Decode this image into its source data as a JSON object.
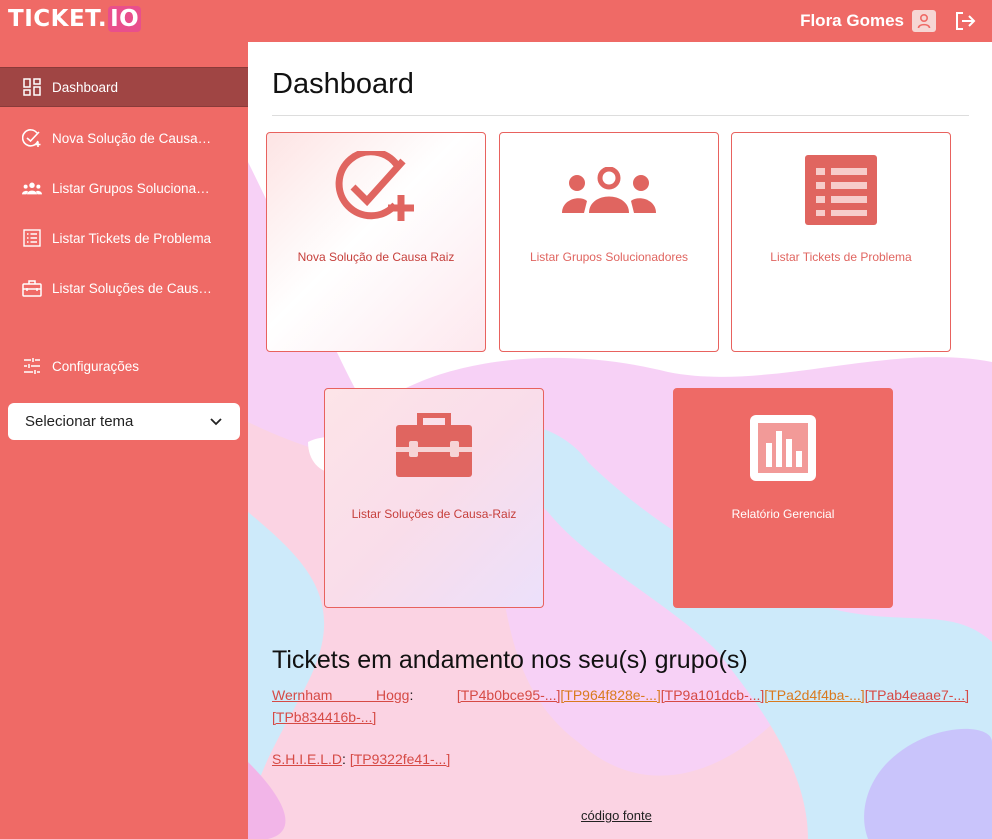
{
  "app": {
    "logo_main": "TICKET.",
    "logo_suffix": "IO"
  },
  "header": {
    "user_name": "Flora Gomes"
  },
  "sidebar": {
    "items": [
      {
        "label": "Dashboard",
        "icon": "dashboard-icon"
      },
      {
        "label": "Nova Solução de Causa Raiz",
        "icon": "check-plus-icon"
      },
      {
        "label": "Listar Grupos Solucionadores",
        "icon": "group-icon"
      },
      {
        "label": "Listar Tickets de Problema",
        "icon": "list-icon"
      },
      {
        "label": "Listar Soluções de Causa-Raiz",
        "icon": "toolbox-icon"
      },
      {
        "label": "Configurações",
        "icon": "sliders-icon"
      }
    ],
    "theme_select": "Selecionar tema"
  },
  "main": {
    "title": "Dashboard",
    "cards": [
      {
        "label": "Nova Solução de Causa Raiz",
        "icon": "check-plus-icon"
      },
      {
        "label": "Listar Grupos Solucionadores",
        "icon": "group-icon"
      },
      {
        "label": "Listar Tickets de Problema",
        "icon": "list-icon"
      },
      {
        "label": "Listar Soluções de Causa-Raiz",
        "icon": "toolbox-icon"
      },
      {
        "label": "Relatório Gerencial",
        "icon": "bar-chart-icon"
      }
    ],
    "tickets_title": "Tickets em andamento nos seu(s) grupo(s)",
    "groups": [
      {
        "name": "Wernham Hogg",
        "tickets": [
          "[TP4b0bce95-...]",
          "[TP964f828e-...]",
          "[TP9a101dcb-...]",
          "[TPa2d4f4ba-...]",
          "[TPab4eaae7-...]",
          "[TPb834416b-...]"
        ]
      },
      {
        "name": "S.H.I.E.L.D",
        "tickets": [
          "[TP9322fe41-...]"
        ]
      }
    ],
    "separator": ":",
    "footer_link": "código fonte"
  },
  "colors": {
    "brand": "#ef6a66",
    "active": "#a04544",
    "link": "#d64a45",
    "link_alt": "#d97a1e"
  }
}
